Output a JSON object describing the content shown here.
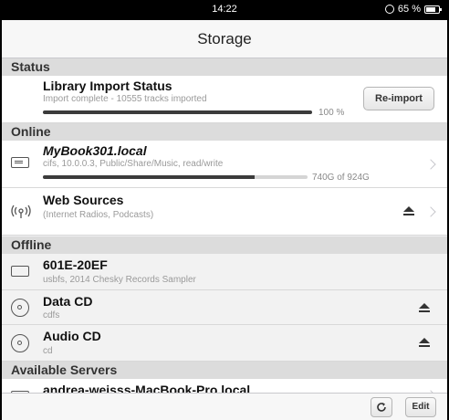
{
  "statusbar": {
    "time": "14:22",
    "battery_text": "65 %"
  },
  "navbar": {
    "title": "Storage"
  },
  "sections": {
    "status": "Status",
    "online": "Online",
    "offline": "Offline",
    "servers": "Available Servers"
  },
  "library": {
    "title": "Library Import Status",
    "subtitle": "Import complete - 10555 tracks imported",
    "progress_text": "100 %",
    "progress": 1.0,
    "button": "Re-import"
  },
  "online_items": [
    {
      "title": "MyBook301.local",
      "subtitle": "cifs, 10.0.0.3, Public/Share/Music, read/write",
      "usage_text": "740G of 924G",
      "usage": 0.8
    },
    {
      "title": "Web Sources",
      "subtitle": "(Internet Radios, Podcasts)"
    }
  ],
  "offline_items": [
    {
      "title": "601E-20EF",
      "subtitle": "usbfs, 2014 Chesky Records Sampler"
    },
    {
      "title": "Data CD",
      "subtitle": "cdfs"
    },
    {
      "title": "Audio CD",
      "subtitle": "cd"
    }
  ],
  "servers": [
    {
      "title": "andrea-weisss-MacBook-Pro.local"
    }
  ],
  "toolbar": {
    "edit_label": "Edit"
  }
}
